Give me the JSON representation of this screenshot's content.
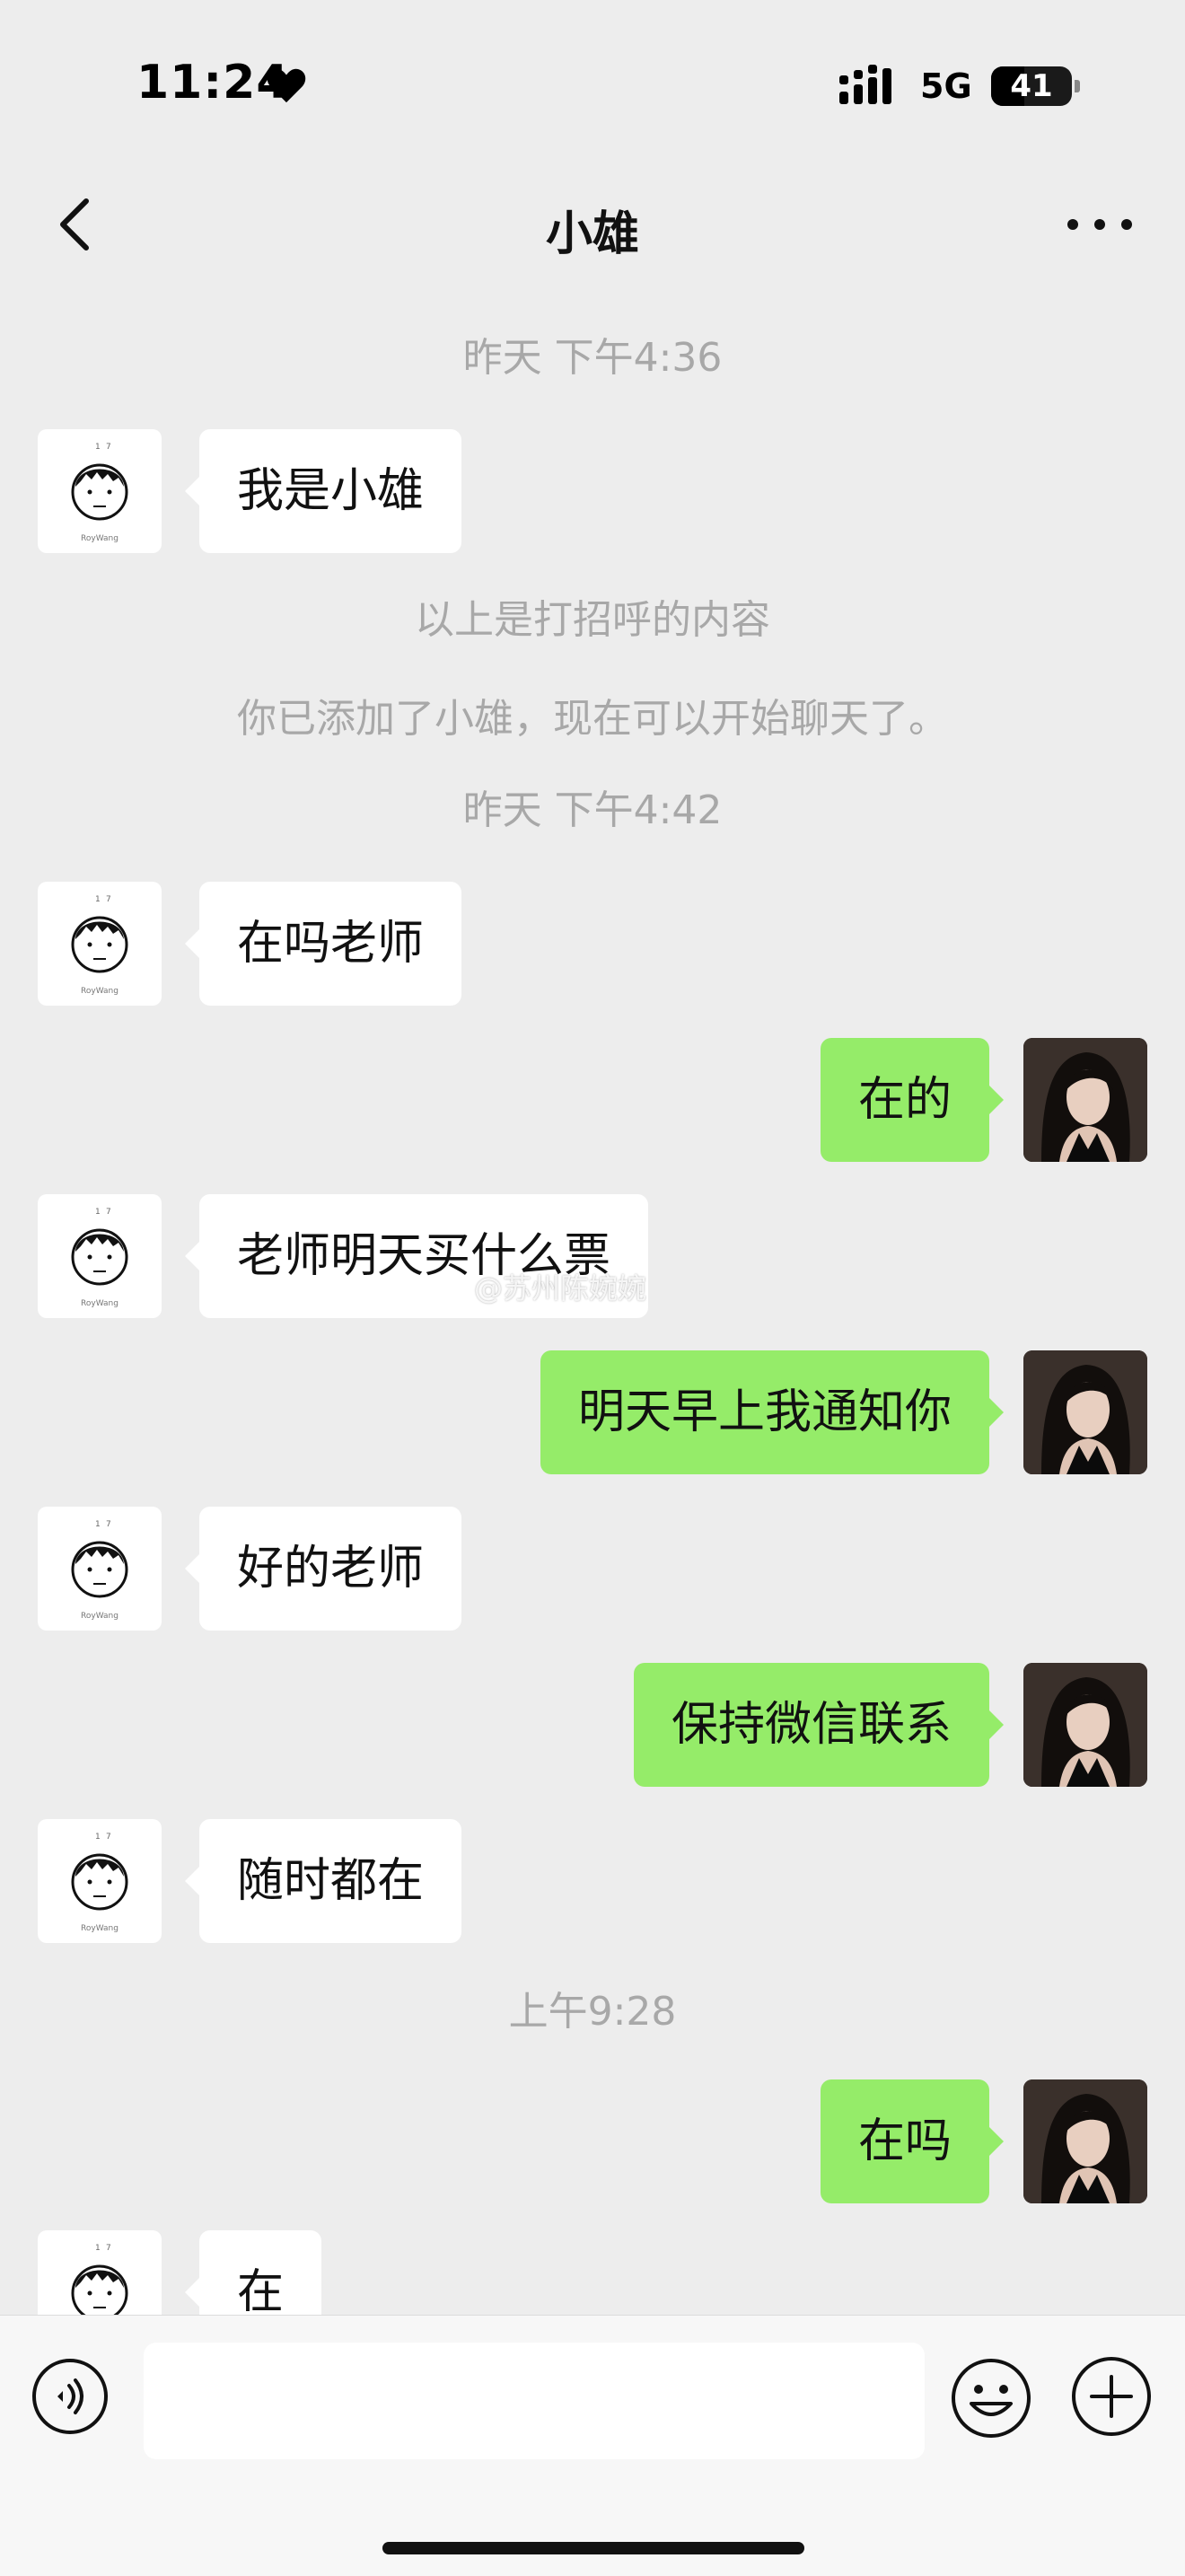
{
  "status_bar": {
    "time": "11:24",
    "network": "5G",
    "battery": "41",
    "battery_level": 0.41
  },
  "header": {
    "title": "小雄",
    "back_icon": "chevron-left-icon",
    "more_icon": "more-horizontal-icon"
  },
  "chat": {
    "timestamps": [
      "昨天 下午4:36",
      "昨天 下午4:42",
      "上午9:28"
    ],
    "system_messages": [
      "以上是打招呼的内容",
      "你已添加了小雄，现在可以开始聊天了。"
    ],
    "messages": [
      {
        "from": "other",
        "text": "我是小雄"
      },
      {
        "from": "other",
        "text": "在吗老师"
      },
      {
        "from": "me",
        "text": "在的"
      },
      {
        "from": "other",
        "text": "老师明天买什么票"
      },
      {
        "from": "me",
        "text": "明天早上我通知你"
      },
      {
        "from": "other",
        "text": "好的老师"
      },
      {
        "from": "me",
        "text": "保持微信联系"
      },
      {
        "from": "other",
        "text": "随时都在"
      },
      {
        "from": "me",
        "text": "在吗"
      },
      {
        "from": "other",
        "text": "在"
      }
    ],
    "avatar_caption": "RoyWang",
    "watermark": "@苏州陈婉婉"
  },
  "input_bar": {
    "value": "",
    "placeholder": "",
    "voice_icon": "voice-icon",
    "emoji_icon": "emoji-icon",
    "plus_icon": "plus-circle-icon"
  },
  "colors": {
    "background": "#ededed",
    "outgoing_bubble": "#95ec69",
    "incoming_bubble": "#ffffff",
    "timestamp_text": "#a8a8a8"
  }
}
